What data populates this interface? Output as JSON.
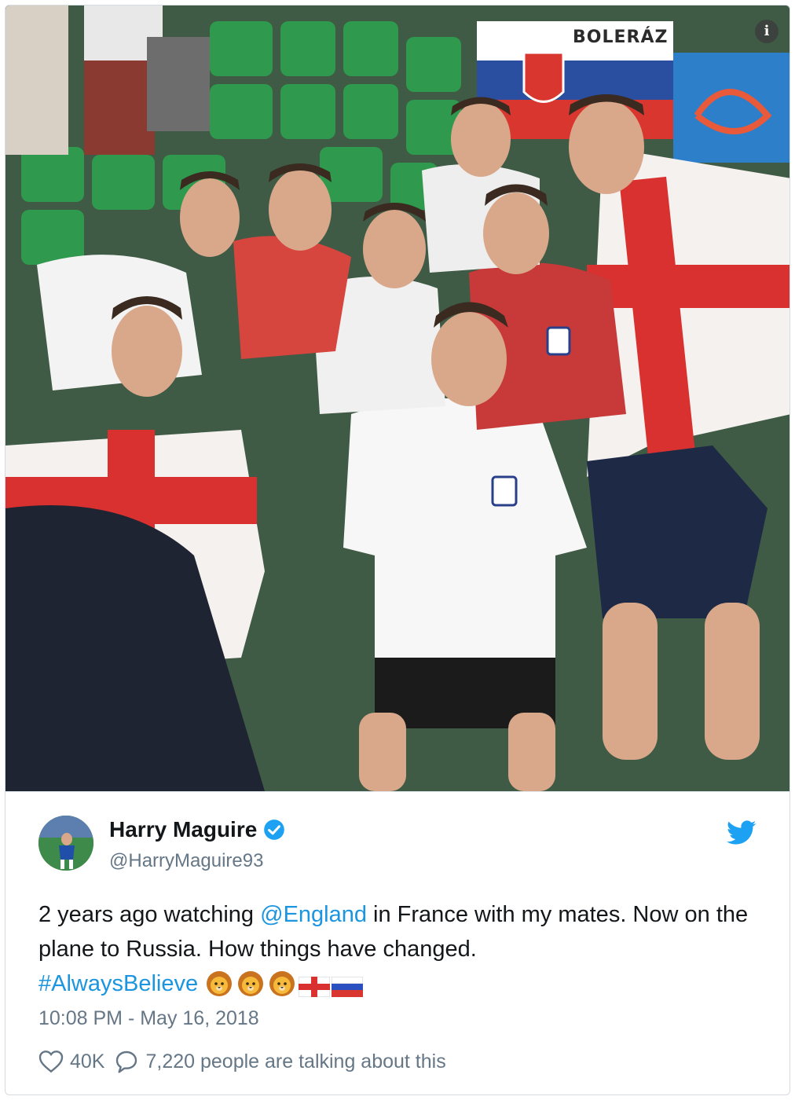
{
  "photo": {
    "banner_text": "BOLERÁZ",
    "info_button": "i"
  },
  "author": {
    "display_name": "Harry Maguire",
    "handle": "@HarryMaguire93",
    "verified": true
  },
  "tweet": {
    "text_part1": "2 years ago watching ",
    "mention": "@England",
    "text_part2": " in France with my mates. Now on the plane to Russia. How things have changed.",
    "hashtag": "#AlwaysBelieve",
    "emojis": [
      "lion-face",
      "lion-face",
      "lion-face",
      "england-flag",
      "russia-flag"
    ],
    "timestamp": "10:08 PM - May 16, 2018"
  },
  "actions": {
    "likes": "40K",
    "conversation": "7,220 people are talking about this"
  },
  "colors": {
    "link": "#1b95e0",
    "secondary_text": "#657786",
    "twitter_blue": "#1da1f2"
  }
}
